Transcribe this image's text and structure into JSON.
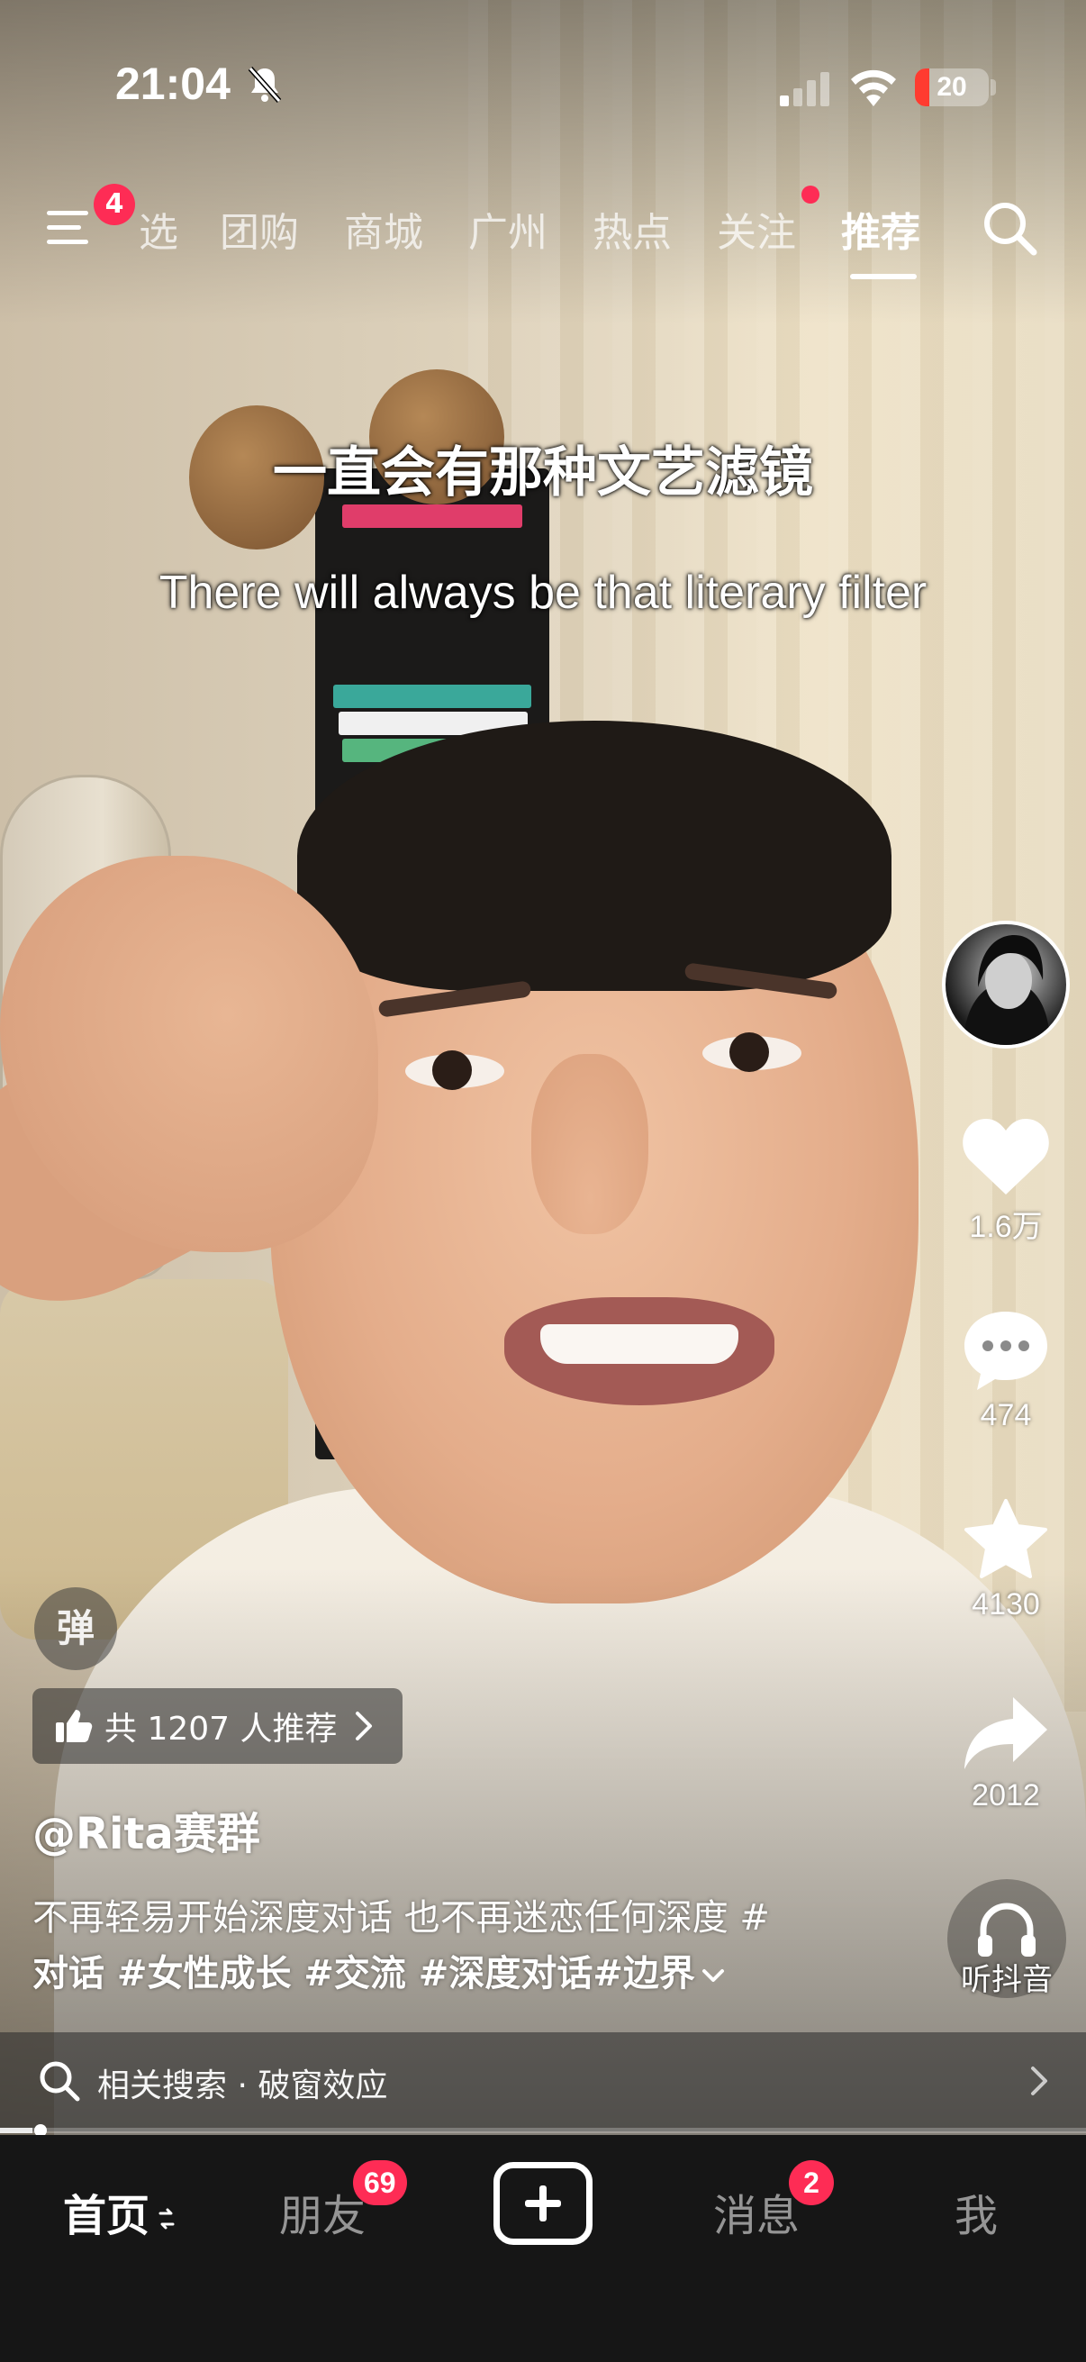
{
  "status_bar": {
    "time": "21:04",
    "battery_level": "20",
    "battery_color": "#ff3b30",
    "icons": [
      "bell-slash-icon",
      "signal-icon",
      "wifi-icon",
      "battery-icon"
    ]
  },
  "top_nav": {
    "menu_badge": "4",
    "tabs": [
      {
        "label": "选",
        "active": false
      },
      {
        "label": "团购",
        "active": false
      },
      {
        "label": "商城",
        "active": false
      },
      {
        "label": "广州",
        "active": false
      },
      {
        "label": "热点",
        "active": false
      },
      {
        "label": "关注",
        "active": false,
        "dot": true
      },
      {
        "label": "推荐",
        "active": true
      }
    ],
    "accent_color": "#fe2c55"
  },
  "subtitles": {
    "chinese": "一直会有那种文艺滤镜",
    "english": "There will always be that literary filter"
  },
  "actions": {
    "likes": "1.6万",
    "comments": "474",
    "favorites": "4130",
    "shares": "2012",
    "listen_label": "听抖音"
  },
  "video_info": {
    "danmu_label": "弹",
    "recommend_text": "共 1207 人推荐",
    "author": "@Rita赛群",
    "description_line1": "不再轻易开始深度对话 也不再迷恋任何深度 #",
    "description_line2": "对话 #女性成长 #交流 #深度对话#边界",
    "related_search": "相关搜索 · 破窗效应"
  },
  "playback": {
    "progress_fraction": 0.03
  },
  "tab_bar": {
    "tabs": [
      {
        "label": "首页",
        "active": true
      },
      {
        "label": "朋友",
        "badge": "69"
      },
      {
        "label": "",
        "icon": "plus-icon"
      },
      {
        "label": "消息",
        "badge": "2"
      },
      {
        "label": "我"
      }
    ]
  }
}
